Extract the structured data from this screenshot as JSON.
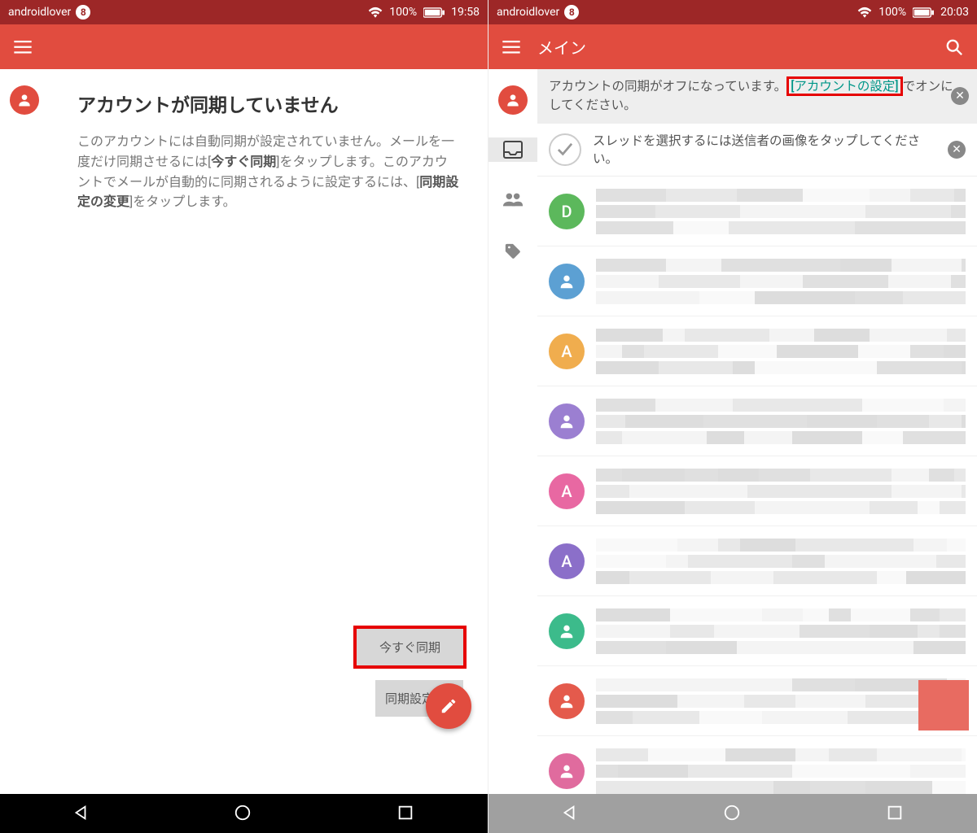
{
  "left": {
    "status": {
      "user": "androidlover",
      "notif_count": "8",
      "battery": "100%",
      "time": "19:58"
    },
    "header": {
      "title": ""
    },
    "message": {
      "title": "アカウントが同期していません",
      "body_pre": "このアカウントには自動同期が設定されていません。メールを一度だけ同期させるには[",
      "body_b1": "今すぐ同期",
      "body_mid": "]をタップします。このアカウントでメールが自動的に同期されるように設定するには、[",
      "body_b2": "同期設定の変更",
      "body_post": "]をタップします。"
    },
    "buttons": {
      "sync_now": "今すぐ同期",
      "change_settings": "同期設定の"
    }
  },
  "right": {
    "status": {
      "user": "androidlover",
      "notif_count": "8",
      "battery": "100%",
      "time": "20:03"
    },
    "header": {
      "title": "メイン"
    },
    "banner": {
      "text_pre": "アカウントの同期がオフになっています。",
      "link": "[アカウントの設定]",
      "text_post": "でオンにしてください。"
    },
    "tip": {
      "text": "スレッドを選択するには送信者の画像をタップしてください。"
    },
    "avatars": [
      {
        "letter": "D",
        "color": "av-green"
      },
      {
        "letter": "",
        "color": "av-blue",
        "icon": "person"
      },
      {
        "letter": "A",
        "color": "av-orange"
      },
      {
        "letter": "",
        "color": "av-purple",
        "icon": "person"
      },
      {
        "letter": "A",
        "color": "av-pink"
      },
      {
        "letter": "A",
        "color": "av-dpurp"
      },
      {
        "letter": "",
        "color": "av-green2",
        "icon": "person"
      },
      {
        "letter": "",
        "color": "av-red",
        "icon": "person"
      },
      {
        "letter": "",
        "color": "av-pink2",
        "icon": "person"
      }
    ]
  }
}
